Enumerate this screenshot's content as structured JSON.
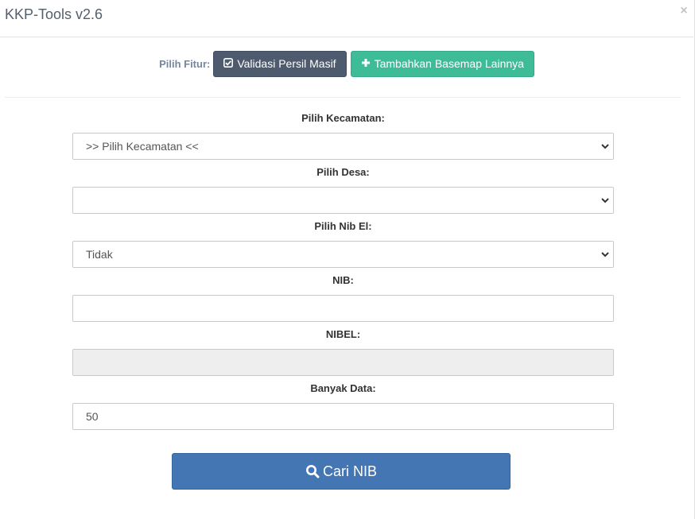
{
  "modal": {
    "title": "KKP-Tools v2.6",
    "close_glyph": "×"
  },
  "features": {
    "label": "Pilih Fitur:",
    "buttons": [
      {
        "label": "Validasi Persil Masif",
        "icon": "check-square-icon",
        "color": "#4e5a6e"
      },
      {
        "label": "Tambahkan Basemap Lainnya",
        "icon": "plus-icon",
        "color": "#3ebc98"
      }
    ]
  },
  "form": {
    "kecamatan": {
      "label": "Pilih Kecamatan:",
      "value": ">> Pilih Kecamatan <<"
    },
    "desa": {
      "label": "Pilih Desa:",
      "value": ""
    },
    "nib_el": {
      "label": "Pilih Nib El:",
      "value": "Tidak"
    },
    "nib": {
      "label": "NIB:",
      "value": ""
    },
    "nibel": {
      "label": "NIBEL:",
      "value": ""
    },
    "banyak_data": {
      "label": "Banyak Data:",
      "value": "50"
    }
  },
  "search_button": {
    "label": "Cari NIB",
    "icon": "search-icon",
    "color": "#4376b3"
  }
}
